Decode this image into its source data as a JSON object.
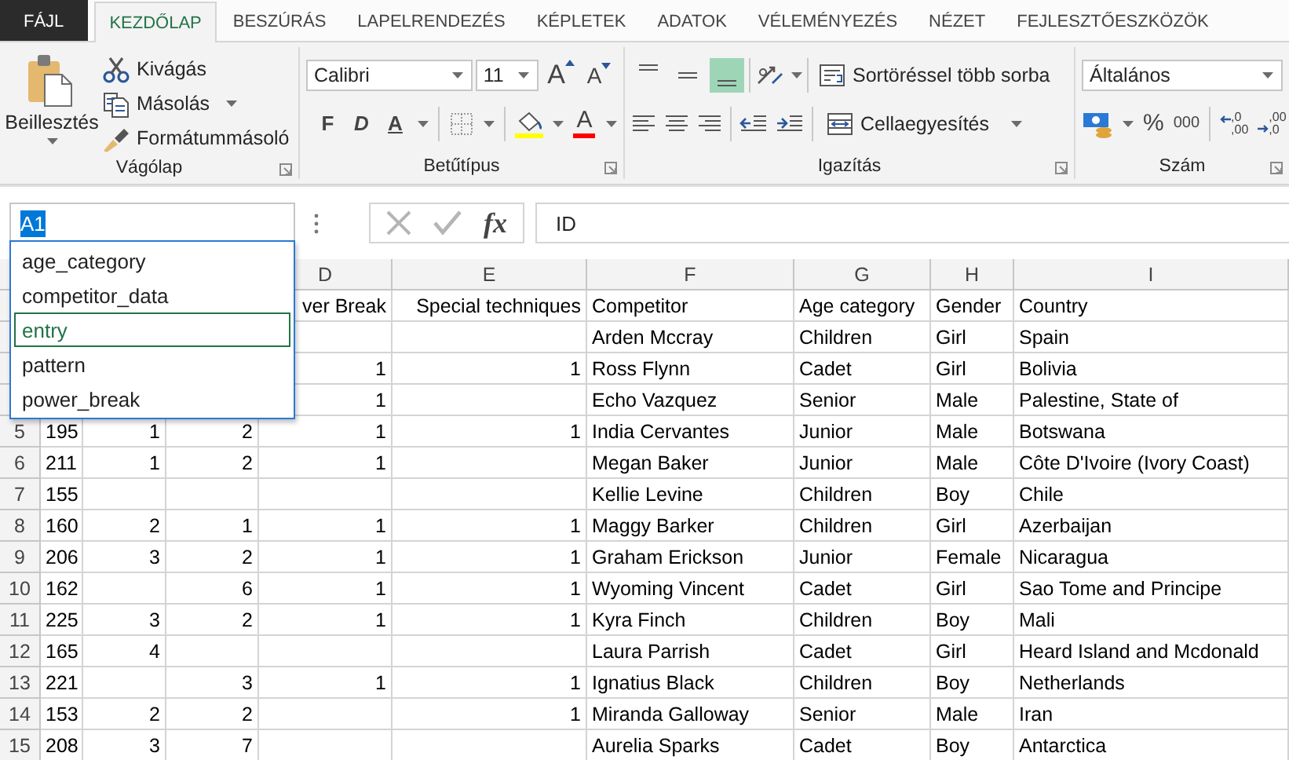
{
  "ribbon_tabs": [
    {
      "label": "FÁJL",
      "kind": "file",
      "selected": false
    },
    {
      "label": "KEZDŐLAP",
      "kind": "tab",
      "selected": true
    },
    {
      "label": "BESZÚRÁS",
      "kind": "tab",
      "selected": false
    },
    {
      "label": "LAPELRENDEZÉS",
      "kind": "tab",
      "selected": false
    },
    {
      "label": "KÉPLETEK",
      "kind": "tab",
      "selected": false
    },
    {
      "label": "ADATOK",
      "kind": "tab",
      "selected": false
    },
    {
      "label": "VÉLEMÉNYEZÉS",
      "kind": "tab",
      "selected": false
    },
    {
      "label": "NÉZET",
      "kind": "tab",
      "selected": false
    },
    {
      "label": "FEJLESZTŐESZKÖZÖK",
      "kind": "tab",
      "selected": false
    }
  ],
  "clipboard": {
    "paste": "Beillesztés",
    "cut": "Kivágás",
    "copy": "Másolás",
    "format_painter": "Formátummásoló",
    "group_label": "Vágólap"
  },
  "font": {
    "name": "Calibri",
    "size": "11",
    "grow": "A",
    "shrink": "A",
    "bold": "F",
    "italic": "D",
    "underline": "A",
    "font_color": "A",
    "group_label": "Betűtípus"
  },
  "alignment": {
    "vertical": [
      {
        "selected": false
      },
      {
        "selected": false
      },
      {
        "selected": true
      }
    ],
    "wrap_text": "Sortöréssel több sorba",
    "merge": "Cellaegyesítés",
    "group_label": "Igazítás"
  },
  "number": {
    "format": "Általános",
    "percent": "%",
    "thousands": "000",
    "increase_decimal": [
      ",0",
      ",00"
    ],
    "decrease_decimal": [
      ",00",
      ",0"
    ],
    "group_label": "Szám"
  },
  "formula_bar": {
    "name_box": "A1",
    "fx": "fx",
    "formula": "ID"
  },
  "name_list": [
    {
      "label": "age_category",
      "selected": false
    },
    {
      "label": "competitor_data",
      "selected": false
    },
    {
      "label": "entry",
      "selected": true
    },
    {
      "label": "pattern",
      "selected": false
    },
    {
      "label": "power_break",
      "selected": false
    }
  ],
  "sheet": {
    "columns": [
      null,
      null,
      null,
      "D",
      "E",
      "F",
      "G",
      "H",
      "I"
    ],
    "rows": [
      {
        "number": null,
        "cells": [
          null,
          null,
          null,
          "ver Break",
          "Special techniques",
          "Competitor",
          "Age category",
          "Gender",
          "Country"
        ]
      },
      {
        "number": null,
        "cells": [
          null,
          null,
          null,
          null,
          null,
          "Arden Mccray",
          "Children",
          "Girl",
          "Spain"
        ]
      },
      {
        "number": null,
        "cells": [
          null,
          null,
          null,
          "1",
          "1",
          "Ross Flynn",
          "Cadet",
          "Girl",
          "Bolivia"
        ]
      },
      {
        "number": null,
        "cells": [
          null,
          null,
          null,
          "1",
          null,
          "Echo Vazquez",
          "Senior",
          "Male",
          "Palestine, State of"
        ]
      },
      {
        "number": "5",
        "cells": [
          "195",
          "1",
          "2",
          "1",
          "1",
          "India Cervantes",
          "Junior",
          "Male",
          "Botswana"
        ]
      },
      {
        "number": "6",
        "cells": [
          "211",
          "1",
          "2",
          "1",
          null,
          "Megan Baker",
          "Junior",
          "Male",
          "Côte D'Ivoire (Ivory Coast)"
        ]
      },
      {
        "number": "7",
        "cells": [
          "155",
          null,
          null,
          null,
          null,
          "Kellie Levine",
          "Children",
          "Boy",
          "Chile"
        ]
      },
      {
        "number": "8",
        "cells": [
          "160",
          "2",
          "1",
          "1",
          "1",
          "Maggy Barker",
          "Children",
          "Girl",
          "Azerbaijan"
        ]
      },
      {
        "number": "9",
        "cells": [
          "206",
          "3",
          "2",
          "1",
          "1",
          "Graham Erickson",
          "Junior",
          "Female",
          "Nicaragua"
        ]
      },
      {
        "number": "10",
        "cells": [
          "162",
          null,
          "6",
          "1",
          "1",
          "Wyoming Vincent",
          "Cadet",
          "Girl",
          "Sao Tome and Principe"
        ]
      },
      {
        "number": "11",
        "cells": [
          "225",
          "3",
          "2",
          "1",
          "1",
          "Kyra Finch",
          "Children",
          "Boy",
          "Mali"
        ]
      },
      {
        "number": "12",
        "cells": [
          "165",
          "4",
          null,
          null,
          null,
          "Laura Parrish",
          "Cadet",
          "Girl",
          "Heard Island and Mcdonald"
        ]
      },
      {
        "number": "13",
        "cells": [
          "221",
          null,
          "3",
          "1",
          "1",
          "Ignatius Black",
          "Children",
          "Boy",
          "Netherlands"
        ]
      },
      {
        "number": "14",
        "cells": [
          "153",
          "2",
          "2",
          null,
          "1",
          "Miranda Galloway",
          "Senior",
          "Male",
          "Iran"
        ]
      },
      {
        "number": "15",
        "cells": [
          "208",
          "3",
          "7",
          null,
          null,
          "Aurelia Sparks",
          "Cadet",
          "Boy",
          "Antarctica"
        ]
      }
    ]
  }
}
